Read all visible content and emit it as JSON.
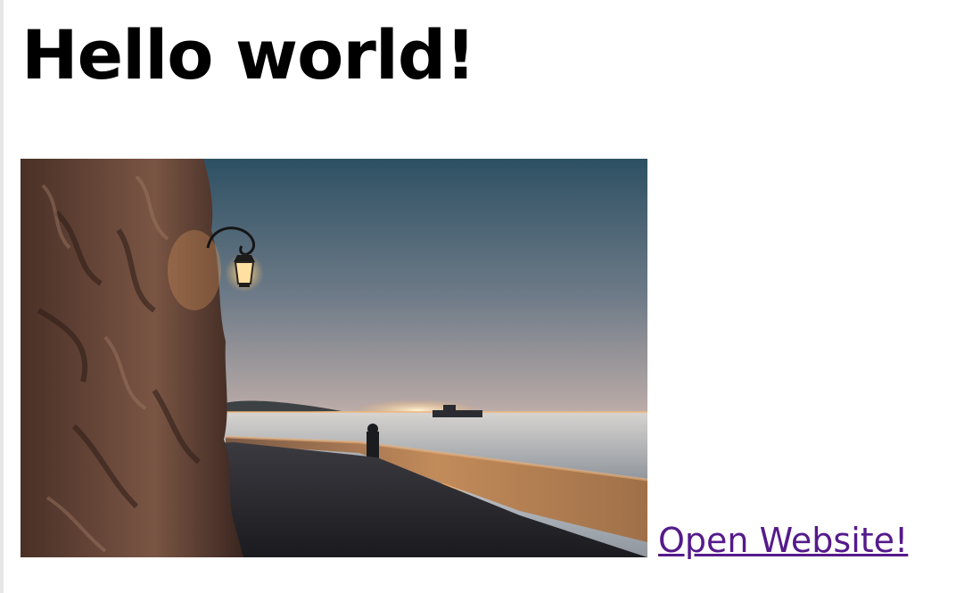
{
  "page": {
    "title": "Hello world!",
    "link_text": "Open Website!"
  },
  "image": {
    "subject": "seaside-promenade-sunset-photo",
    "colors": {
      "sky_top": "#2f5366",
      "sky_mid": "#8b8d98",
      "horizon": "#f4b06b",
      "sea": "#b9c0c8",
      "rock": "#6b4c3c",
      "wall": "#c48c5b",
      "path": "#2a2a2e"
    }
  },
  "colors": {
    "visited_link": "#551a8b",
    "text": "#000000",
    "background": "#ffffff"
  }
}
